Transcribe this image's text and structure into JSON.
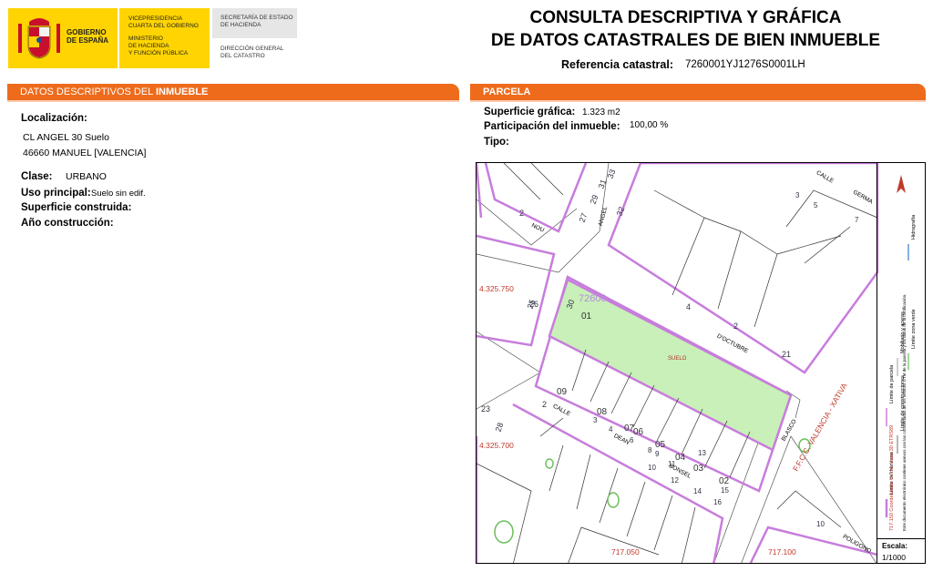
{
  "header": {
    "gov_name": [
      "GOBIERNO",
      "DE ESPAÑA"
    ],
    "ministry": "VICEPRESIDENCIA\nCUARTA DEL GOBIERNO",
    "ministry2": "MINISTERIO\nDE HACIENDA\nY FUNCIÓN PÚBLICA",
    "secretariat": "SECRETARÍA DE ESTADO\nDE HACIENDA",
    "directorate": "DIRECCIÓN GENERAL\nDEL CATASTRO",
    "title_line1": "CONSULTA DESCRIPTIVA Y GRÁFICA",
    "title_line2": "DE DATOS CATASTRALES DE BIEN INMUEBLE",
    "ref_label": "Referencia catastral:",
    "ref_value": "7260001YJ1276S0001LH"
  },
  "left": {
    "section_title_plain": "DATOS DESCRIPTIVOS DEL ",
    "section_title_bold": "INMUEBLE",
    "localizacion_label": "Localización:",
    "address1": "CL ANGEL 30 Suelo",
    "address2": "46660 MANUEL [VALENCIA]",
    "clase_label": "Clase:",
    "clase_value": "URBANO",
    "uso_label": "Uso principal:",
    "uso_value": "Suelo sin edif.",
    "superficie_label": "Superficie construida:",
    "anio_label": "Año construcción:"
  },
  "right": {
    "section_title": "PARCELA",
    "sup_label": "Superficie gráfica:",
    "sup_value": "1.323 m2",
    "part_label": "Participación del inmueble:",
    "part_value": "100,00 %",
    "tipo_label": "Tipo:"
  },
  "map": {
    "parcel_ref": "72600",
    "parcel_num": "01",
    "parcel_label": "SUELO",
    "street_labels": [
      "CALLE",
      "GERMA",
      "NOU",
      "ANGEL",
      "D'OCTUBRE",
      "CALLE",
      "DEAN",
      "SONSEL",
      "BLASCO",
      "F.F.C.C. VALENCIA - XATIVA",
      "POLIGONO"
    ],
    "coord_y1": "4.325.750",
    "coord_y2": "4.325.700",
    "coord_x1": "717.050",
    "coord_x2": "717.100",
    "numbers": [
      "33",
      "31",
      "29",
      "27",
      "32",
      "2",
      "30",
      "25",
      "4",
      "2",
      "21",
      "09",
      "08",
      "07",
      "06",
      "05",
      "04",
      "03",
      "02",
      "2",
      "3",
      "4",
      "6",
      "8",
      "9",
      "10",
      "12",
      "13",
      "14",
      "15",
      "16",
      "23",
      "28",
      "26",
      "10",
      "3",
      "5",
      "7",
      "11"
    ],
    "legend": {
      "col1": "Límite de manzana",
      "col2": "Límite de parcela",
      "col3": "Límite de construcciones",
      "col4": "Mobiliario y aceras",
      "col5": "Límite zona verde",
      "col6": "Hidrografía",
      "coord_note": "717.150 Coordenadas U.T.M. Huso 30 ETRS89",
      "doc_note": "Este documento electrónico contiene anexos con las coordenadas de los vértices UTM de la parcela y los datos de la certificación."
    },
    "scale_label": "Escala:",
    "scale_value": "1/1000"
  },
  "colors": {
    "accent": "#ee6b1c",
    "gov_yellow": "#ffd400",
    "parcel_fill": "#c8f0b8",
    "block_outline": "#c77ddc"
  }
}
